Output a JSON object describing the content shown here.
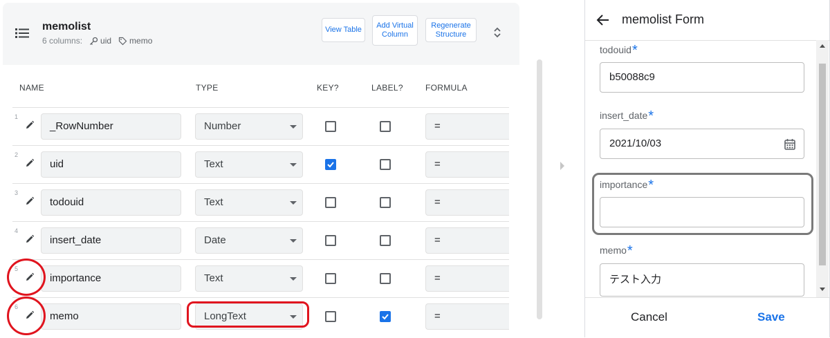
{
  "table": {
    "title": "memolist",
    "columns_count": "6 columns:",
    "key_chip": "uid",
    "label_chip": "memo",
    "buttons": {
      "view_table": "View Table",
      "add_virtual_column": "Add Virtual Column",
      "regenerate_structure": "Regenerate Structure"
    },
    "headers": {
      "name": "NAME",
      "type": "TYPE",
      "key": "KEY?",
      "label": "LABEL?",
      "formula": "FORMULA"
    },
    "rows": [
      {
        "num": "1",
        "name": "_RowNumber",
        "type": "Number",
        "key": false,
        "label": false,
        "formula": "="
      },
      {
        "num": "2",
        "name": "uid",
        "type": "Text",
        "key": true,
        "label": false,
        "formula": "="
      },
      {
        "num": "3",
        "name": "todouid",
        "type": "Text",
        "key": false,
        "label": false,
        "formula": "="
      },
      {
        "num": "4",
        "name": "insert_date",
        "type": "Date",
        "key": false,
        "label": false,
        "formula": "="
      },
      {
        "num": "5",
        "name": "importance",
        "type": "Text",
        "key": false,
        "label": false,
        "formula": "="
      },
      {
        "num": "6",
        "name": "memo",
        "type": "LongText",
        "key": false,
        "label": true,
        "formula": "="
      }
    ]
  },
  "form": {
    "title": "memolist Form",
    "required_mark": "*",
    "fields": [
      {
        "label": "todouid",
        "value": "b50088c9"
      },
      {
        "label": "insert_date",
        "value": "2021/10/03"
      },
      {
        "label": "importance",
        "value": ""
      },
      {
        "label": "memo",
        "value": "テスト入力"
      }
    ],
    "cancel_label": "Cancel",
    "save_label": "Save"
  },
  "colors": {
    "accent": "#1a73e8",
    "annotation_red": "#e0141e",
    "annotation_gray": "#7a7a7a"
  },
  "icons": [
    "list-icon",
    "key-icon",
    "tag-icon",
    "expand-icon",
    "pencil-icon",
    "calendar-icon",
    "back-arrow-icon"
  ]
}
